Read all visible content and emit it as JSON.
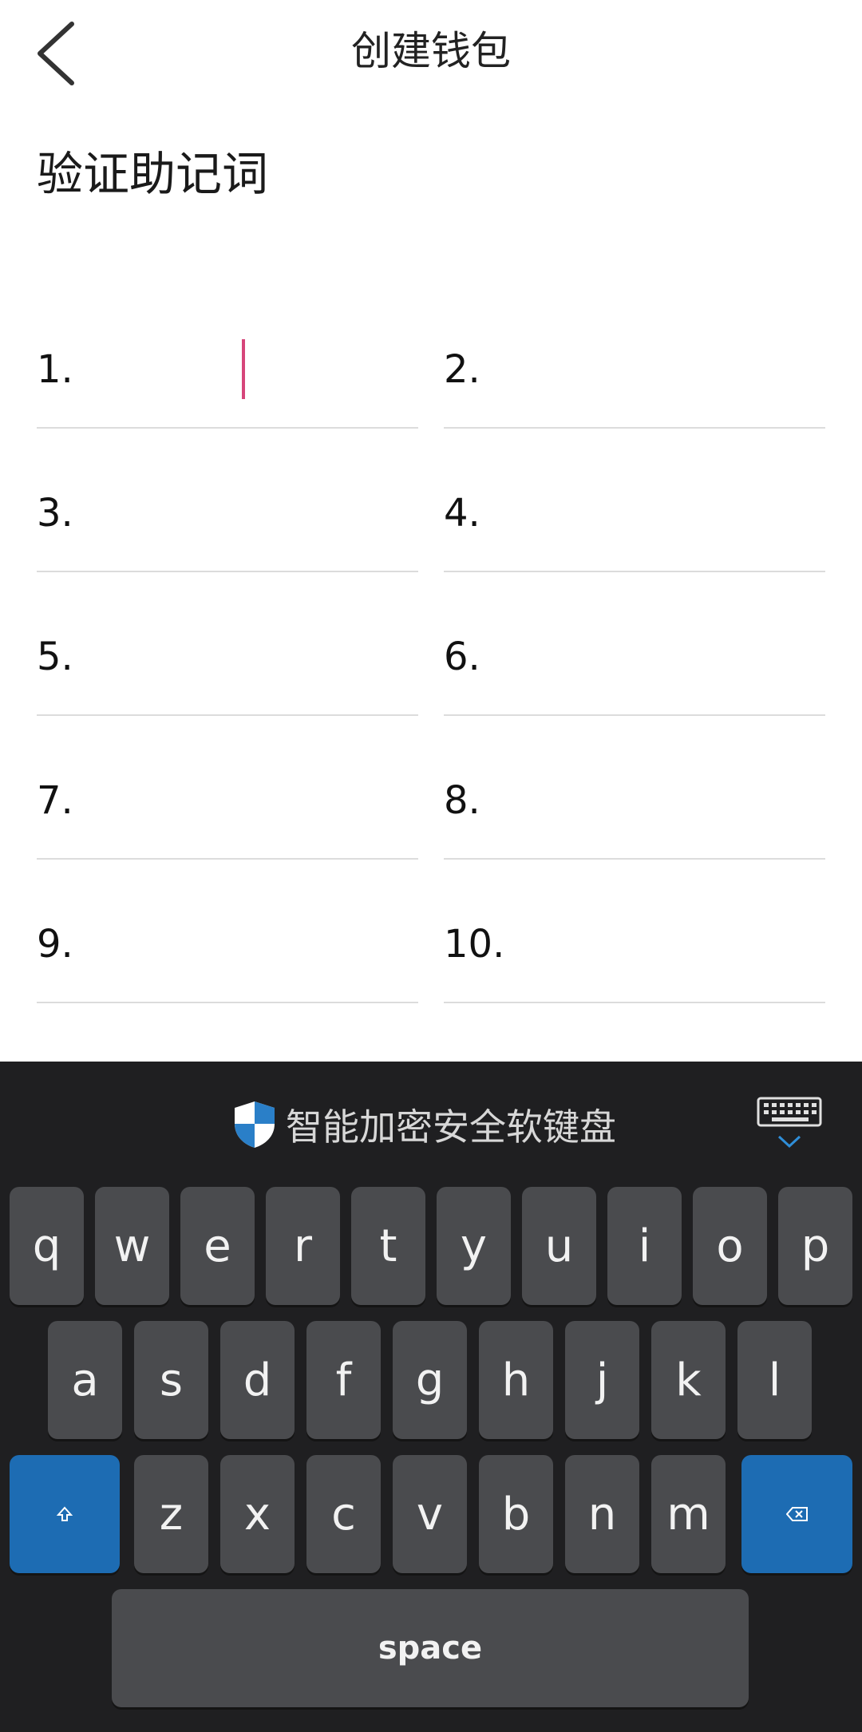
{
  "header": {
    "title": "创建钱包"
  },
  "section": {
    "title": "验证助记词"
  },
  "words": [
    {
      "label": "1."
    },
    {
      "label": "2."
    },
    {
      "label": "3."
    },
    {
      "label": "4."
    },
    {
      "label": "5."
    },
    {
      "label": "6."
    },
    {
      "label": "7."
    },
    {
      "label": "8."
    },
    {
      "label": "9."
    },
    {
      "label": "10."
    }
  ],
  "keyboard": {
    "title": "智能加密安全软键盘",
    "row1": [
      "q",
      "w",
      "e",
      "r",
      "t",
      "y",
      "u",
      "i",
      "o",
      "p"
    ],
    "row2": [
      "a",
      "s",
      "d",
      "f",
      "g",
      "h",
      "j",
      "k",
      "l"
    ],
    "row3": [
      "z",
      "x",
      "c",
      "v",
      "b",
      "n",
      "m"
    ],
    "space": "space",
    "shift_icon": "shift-icon",
    "delete_icon": "backspace-icon",
    "hide_icon": "keyboard-hide-icon",
    "accent_color": "#1d6cb3",
    "cursor_color": "#d6457a"
  }
}
